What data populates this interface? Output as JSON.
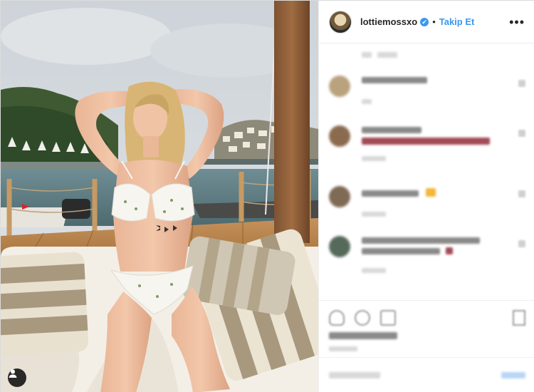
{
  "post": {
    "username": "lottiemossxo",
    "verified_mark": "✔",
    "separator": "•",
    "follow_label": "Takip Et",
    "more_label": "•••"
  },
  "icons": {
    "verified": "verified-badge-icon",
    "more": "more-options-icon",
    "user_tag": "user-tag-icon",
    "like": "heart-icon",
    "comment": "comment-icon",
    "share": "share-icon",
    "save": "bookmark-icon"
  },
  "colors": {
    "accent": "#3897f0",
    "text": "#262626",
    "border": "#dbdbdb"
  }
}
